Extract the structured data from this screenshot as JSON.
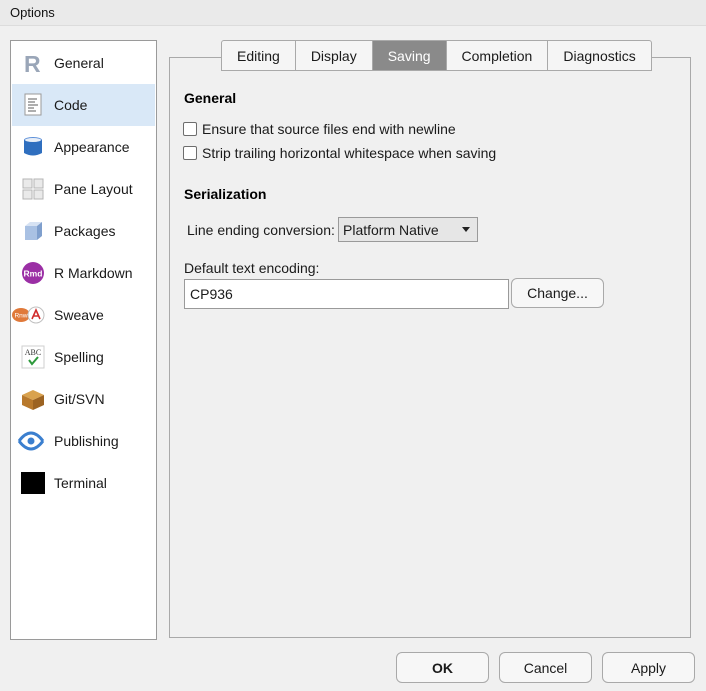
{
  "window": {
    "title": "Options"
  },
  "sidebar": {
    "items": [
      {
        "label": "General",
        "icon": "r-logo-icon"
      },
      {
        "label": "Code",
        "icon": "code-document-icon",
        "active": true
      },
      {
        "label": "Appearance",
        "icon": "paint-bucket-icon"
      },
      {
        "label": "Pane Layout",
        "icon": "pane-layout-icon"
      },
      {
        "label": "Packages",
        "icon": "package-cube-icon"
      },
      {
        "label": "R Markdown",
        "icon": "rmd-icon"
      },
      {
        "label": "Sweave",
        "icon": "sweave-icon"
      },
      {
        "label": "Spelling",
        "icon": "spellcheck-icon"
      },
      {
        "label": "Git/SVN",
        "icon": "git-box-icon"
      },
      {
        "label": "Publishing",
        "icon": "publishing-icon"
      },
      {
        "label": "Terminal",
        "icon": "terminal-icon"
      }
    ],
    "rmd_badge": "Rmd",
    "sweave_badge": "Rnw",
    "spelling_badge": "ABC"
  },
  "tabs": [
    "Editing",
    "Display",
    "Saving",
    "Completion",
    "Diagnostics"
  ],
  "active_tab": "Saving",
  "saving": {
    "general_title": "General",
    "ensure_newline": "Ensure that source files end with newline",
    "strip_whitespace": "Strip trailing horizontal whitespace when saving",
    "serialization_title": "Serialization",
    "line_ending_label": "Line ending conversion:",
    "line_ending_value": "Platform Native",
    "encoding_label": "Default text encoding:",
    "encoding_value": "CP936",
    "change_button": "Change..."
  },
  "footer": {
    "ok": "OK",
    "cancel": "Cancel",
    "apply": "Apply"
  },
  "colors": {
    "active_sidebar": "#d9e8f7",
    "active_tab": "#8a8a8a"
  }
}
